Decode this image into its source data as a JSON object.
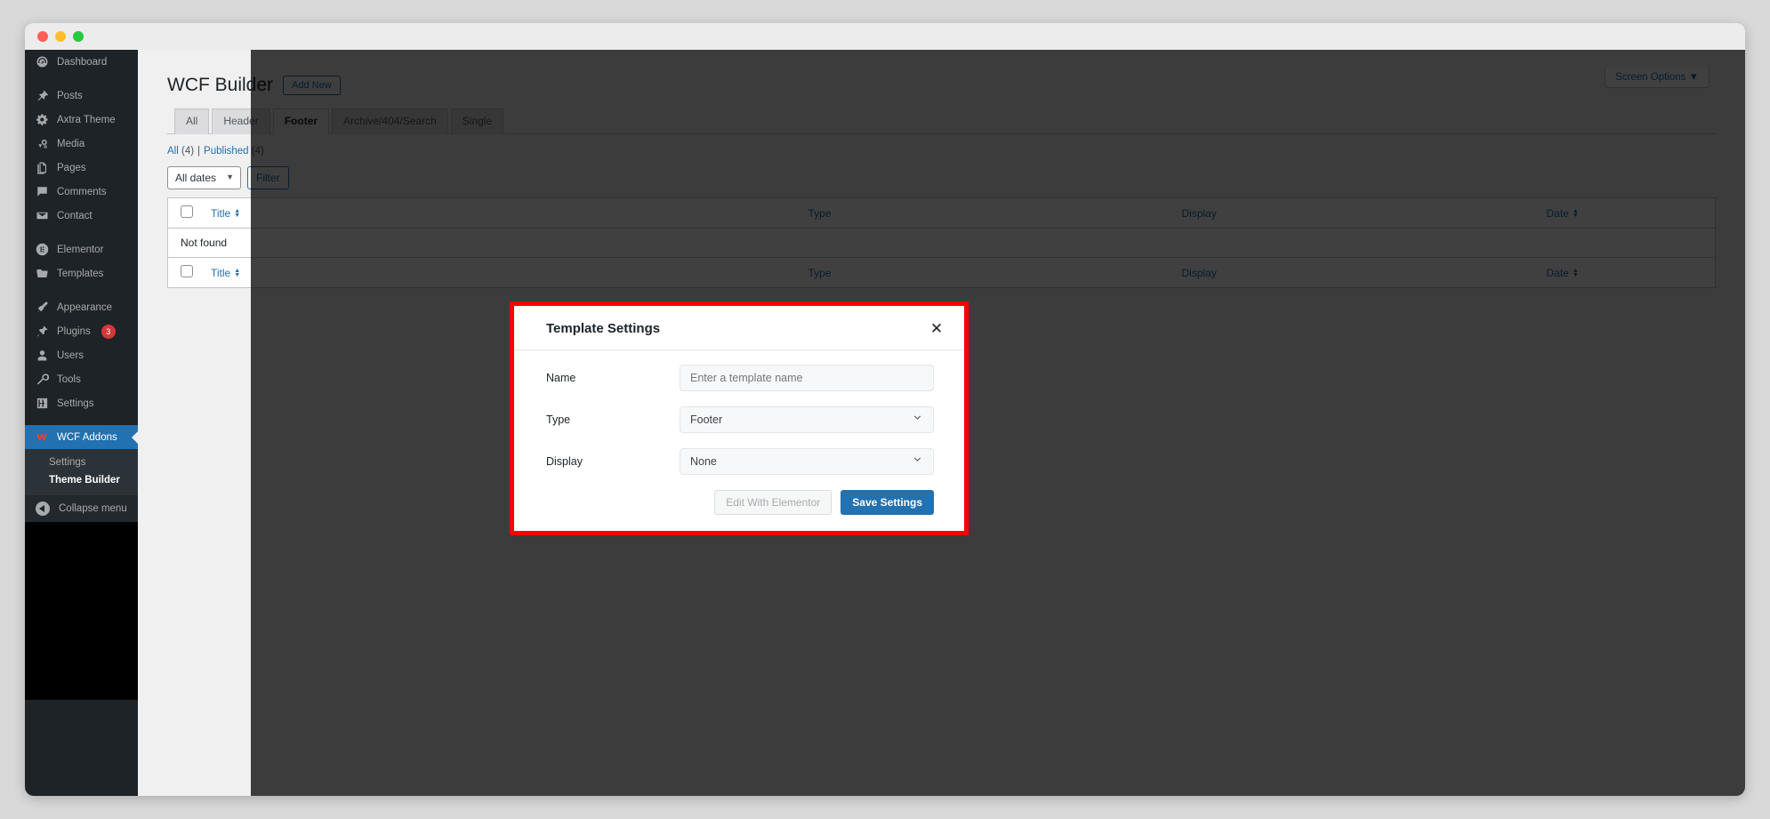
{
  "window": {
    "traffic_lights": [
      "close",
      "minimize",
      "maximize"
    ]
  },
  "sidebar": {
    "items": [
      {
        "label": "Dashboard",
        "icon": "dashboard-icon",
        "gap_after": true
      },
      {
        "label": "Posts",
        "icon": "pin-icon"
      },
      {
        "label": "Axtra Theme",
        "icon": "gear-icon"
      },
      {
        "label": "Media",
        "icon": "media-icon"
      },
      {
        "label": "Pages",
        "icon": "pages-icon"
      },
      {
        "label": "Comments",
        "icon": "comments-icon"
      },
      {
        "label": "Contact",
        "icon": "envelope-icon",
        "gap_after": true
      },
      {
        "label": "Elementor",
        "icon": "elementor-icon"
      },
      {
        "label": "Templates",
        "icon": "folder-icon",
        "gap_after": true
      },
      {
        "label": "Appearance",
        "icon": "paintbrush-icon"
      },
      {
        "label": "Plugins",
        "icon": "plug-icon",
        "badge": "3"
      },
      {
        "label": "Users",
        "icon": "user-icon"
      },
      {
        "label": "Tools",
        "icon": "wrench-icon"
      },
      {
        "label": "Settings",
        "icon": "sliders-icon",
        "gap_after": true
      },
      {
        "label": "WCF Addons",
        "icon": "wcf-logo-icon",
        "current": true
      }
    ],
    "submenu": [
      {
        "label": "Settings",
        "current": false
      },
      {
        "label": "Theme Builder",
        "current": true
      }
    ],
    "collapse": {
      "label": "Collapse menu",
      "icon": "collapse-arrow-icon"
    }
  },
  "screen_options": {
    "label": "Screen Options",
    "caret": "▼"
  },
  "page": {
    "title": "WCF Builder",
    "add_new_label": "Add New",
    "tabs": [
      {
        "label": "All",
        "active": false
      },
      {
        "label": "Header",
        "active": false
      },
      {
        "label": "Footer",
        "active": true
      },
      {
        "label": "Archive/404/Search",
        "active": false
      },
      {
        "label": "Single",
        "active": false
      }
    ],
    "status_links": {
      "all_label": "All",
      "all_count": "(4)",
      "separator": "|",
      "published_label": "Published",
      "published_count": "(4)"
    },
    "tablenav": {
      "date_filter_value": "All dates",
      "filter_button": "Filter"
    },
    "table": {
      "columns": [
        "Title",
        "Type",
        "Display",
        "Date"
      ],
      "sortable": [
        true,
        false,
        false,
        true
      ],
      "empty_message": "Not found"
    }
  },
  "modal": {
    "title": "Template Settings",
    "close_icon": "✕",
    "fields": [
      {
        "label": "Name",
        "type": "text",
        "value": "",
        "placeholder": "Enter a template name"
      },
      {
        "label": "Type",
        "type": "select",
        "value": "Footer"
      },
      {
        "label": "Display",
        "type": "select",
        "value": "None"
      }
    ],
    "buttons": {
      "secondary": "Edit With Elementor",
      "primary": "Save Settings"
    },
    "highlight_color": "#ff0000"
  },
  "colors": {
    "wp_blue": "#2271b1",
    "sidebar_bg": "#1d2327",
    "submenu_bg": "#2c3338",
    "badge_red": "#d63638",
    "content_bg": "#f0f0f1"
  }
}
